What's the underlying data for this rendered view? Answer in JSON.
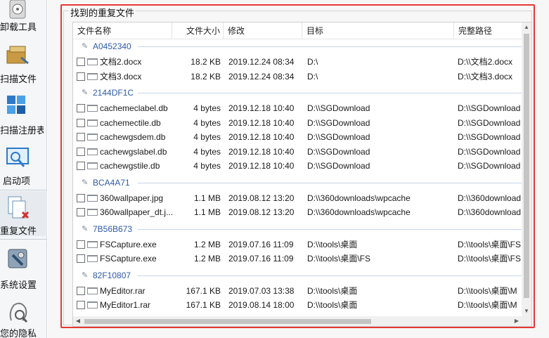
{
  "sidebar": {
    "items": [
      {
        "label": "卸载工具",
        "icon": "uninstall-icon"
      },
      {
        "label": "扫描文件",
        "icon": "scan-files-icon"
      },
      {
        "label": "扫描注册表",
        "icon": "registry-icon"
      },
      {
        "label": "启动项",
        "icon": "startup-icon"
      },
      {
        "label": "重复文件",
        "icon": "duplicate-files-icon"
      },
      {
        "label": "系统设置",
        "icon": "settings-icon"
      },
      {
        "label": "您的隐私",
        "icon": "privacy-icon"
      }
    ],
    "active": "重复文件"
  },
  "panel": {
    "title": "找到的重复文件",
    "columns": [
      "文件名称",
      "文件大小",
      "修改",
      "目标",
      "完整路径"
    ]
  },
  "groups": [
    {
      "hash": "A0452340",
      "files": [
        {
          "name": "文档2.docx",
          "size": "18.2 KB",
          "modified": "2019.12.24 08:34",
          "target": "D:\\",
          "path": "D:\\\\文档2.docx"
        },
        {
          "name": "文档3.docx",
          "size": "18.2 KB",
          "modified": "2019.12.24 08:34",
          "target": "D:\\",
          "path": "D:\\\\文档3.docx"
        }
      ]
    },
    {
      "hash": "2144DF1C",
      "files": [
        {
          "name": "cachemeclabel.db",
          "size": "4 bytes",
          "modified": "2019.12.18 10:40",
          "target": "D:\\\\SGDownload",
          "path": "D:\\\\SGDownload"
        },
        {
          "name": "cachemectile.db",
          "size": "4 bytes",
          "modified": "2019.12.18 10:40",
          "target": "D:\\\\SGDownload",
          "path": "D:\\\\SGDownload"
        },
        {
          "name": "cachewgsdem.db",
          "size": "4 bytes",
          "modified": "2019.12.18 10:40",
          "target": "D:\\\\SGDownload",
          "path": "D:\\\\SGDownload"
        },
        {
          "name": "cachewgslabel.db",
          "size": "4 bytes",
          "modified": "2019.12.18 10:40",
          "target": "D:\\\\SGDownload",
          "path": "D:\\\\SGDownload"
        },
        {
          "name": "cachewgstile.db",
          "size": "4 bytes",
          "modified": "2019.12.18 10:40",
          "target": "D:\\\\SGDownload",
          "path": "D:\\\\SGDownload"
        }
      ]
    },
    {
      "hash": "BCA4A71",
      "files": [
        {
          "name": "360wallpaper.jpg",
          "size": "1.1 MB",
          "modified": "2019.08.12 13:20",
          "target": "D:\\\\360downloads\\wpcache",
          "path": "D:\\\\360download"
        },
        {
          "name": "360wallpaper_dt.j...",
          "size": "1.1 MB",
          "modified": "2019.08.12 13:20",
          "target": "D:\\\\360downloads\\wpcache",
          "path": "D:\\\\360download"
        }
      ]
    },
    {
      "hash": "7B56B673",
      "files": [
        {
          "name": "FSCapture.exe",
          "size": "1.2 MB",
          "modified": "2019.07.16 11:09",
          "target": "D:\\\\tools\\桌面",
          "path": "D:\\\\tools\\桌面\\FS"
        },
        {
          "name": "FSCapture.exe",
          "size": "1.2 MB",
          "modified": "2019.07.16 11:09",
          "target": "D:\\\\tools\\桌面\\FS",
          "path": "D:\\\\tools\\桌面\\FS"
        }
      ]
    },
    {
      "hash": "82F10807",
      "files": [
        {
          "name": "MyEditor.rar",
          "size": "167.1 KB",
          "modified": "2019.07.03 13:38",
          "target": "D:\\\\tools\\桌面",
          "path": "D:\\\\tools\\桌面\\M"
        },
        {
          "name": "MyEditor1.rar",
          "size": "167.1 KB",
          "modified": "2019.08.14 18:00",
          "target": "D:\\\\tools\\桌面",
          "path": "D:\\\\tools\\桌面\\M"
        }
      ]
    }
  ],
  "colors": {
    "accent_frame": "#e53935",
    "group_hash": "#2e5aa8"
  }
}
